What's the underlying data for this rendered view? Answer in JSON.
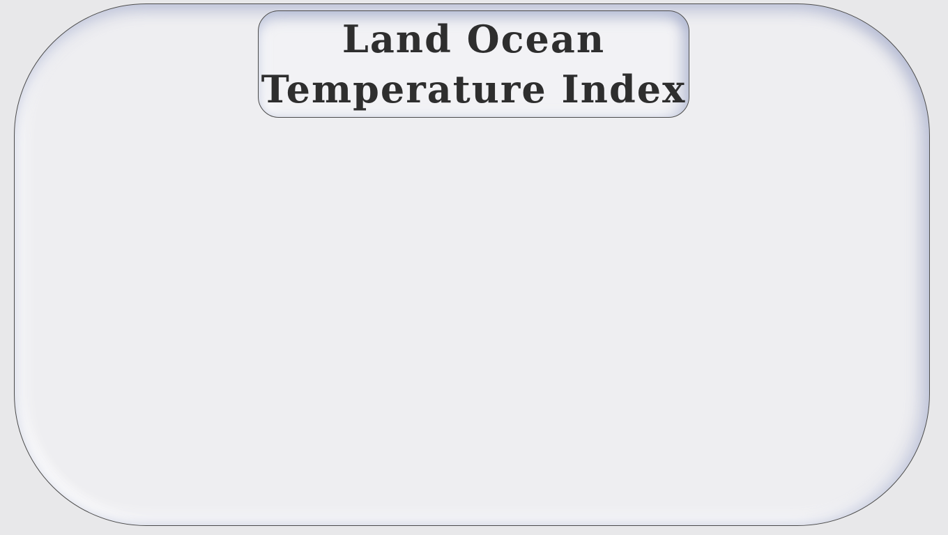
{
  "title": {
    "line1": "Land Ocean",
    "line2": "Temperature Index"
  }
}
